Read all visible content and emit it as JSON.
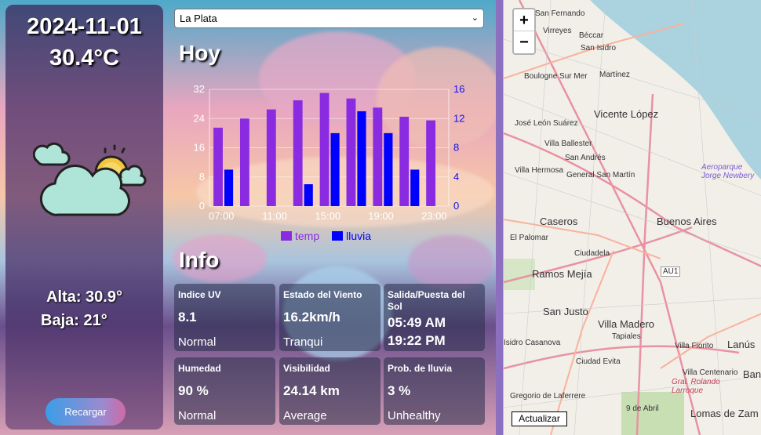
{
  "current": {
    "date": "2024-11-01",
    "temp": "30.4°C",
    "high": "Alta: 30.9°",
    "low": "Baja: 21°",
    "icon": "partly-cloudy-day-icon",
    "reload_label": "Recargar"
  },
  "city": {
    "selected": "La Plata"
  },
  "today": {
    "title": "Hoy",
    "chart_data": {
      "type": "bar",
      "categories": [
        "07:00",
        "09:00",
        "11:00",
        "13:00",
        "15:00",
        "17:00",
        "19:00",
        "21:00",
        "23:00"
      ],
      "x_tick_labels": [
        "07:00",
        "11:00",
        "15:00",
        "19:00",
        "23:00"
      ],
      "series": [
        {
          "name": "temp",
          "axis": "left",
          "color": "#8a2be2",
          "values": [
            21.5,
            24,
            26.5,
            29,
            31,
            29.5,
            27,
            24.5,
            23.5
          ]
        },
        {
          "name": "lluvia",
          "axis": "right",
          "color": "#0000ff",
          "values": [
            5,
            3,
            10,
            13,
            10,
            5
          ]
        },
        {
          "name": "lluvia_x",
          "values": [
            "07:00",
            "13:00",
            "15:00",
            "17:00",
            "19:00",
            "21:00"
          ]
        }
      ],
      "y_left": {
        "ylim": [
          0,
          32
        ],
        "ticks": [
          0,
          8,
          16,
          24,
          32
        ]
      },
      "y_right": {
        "ylim": [
          0,
          16
        ],
        "ticks": [
          0,
          4,
          8,
          12,
          16
        ]
      },
      "legend": "bottom"
    }
  },
  "info": {
    "title": "Info",
    "cards": [
      {
        "title": "Indice UV",
        "value": "8.1",
        "sub": "Normal"
      },
      {
        "title": "Estado del Viento",
        "value": "16.2km/h",
        "sub": "Tranqui"
      },
      {
        "title": "Salida/Puesta del Sol",
        "value": "05:49 AM",
        "sub": "19:22 PM"
      },
      {
        "title": "Humedad",
        "value": "90 %",
        "sub": "Normal"
      },
      {
        "title": "Visibilidad",
        "value": "24.14 km",
        "sub": "Average"
      },
      {
        "title": "Prob. de lluvia",
        "value": "3 %",
        "sub": "Unhealthy"
      }
    ]
  },
  "map": {
    "zoom_in": "+",
    "zoom_out": "−",
    "update_label": "Actualizar",
    "labels": [
      "San Fernando",
      "Virreyes",
      "Béccar",
      "San Isidro",
      "Boulogne Sur Mer",
      "Martínez",
      "Vicente López",
      "José León Suárez",
      "Villa Ballester",
      "San Andrés",
      "General San Martín",
      "Villa Hermosa",
      "Caseros",
      "Buenos Aires",
      "Aeroparque Jorge Newbery",
      "El Palomar",
      "Ciudadela",
      "Ramos Mejía",
      "AU1",
      "San Justo",
      "Villa Madero",
      "Tapiales",
      "Villa Fiorito",
      "Lanús",
      "Isidro Casanova",
      "Ciudad Evita",
      "Villa Centenario",
      "Gral. Rolando Larroque",
      "Banfield",
      "Gregorio de Laferrere",
      "9 de Abril",
      "Lomas de Zam"
    ]
  }
}
